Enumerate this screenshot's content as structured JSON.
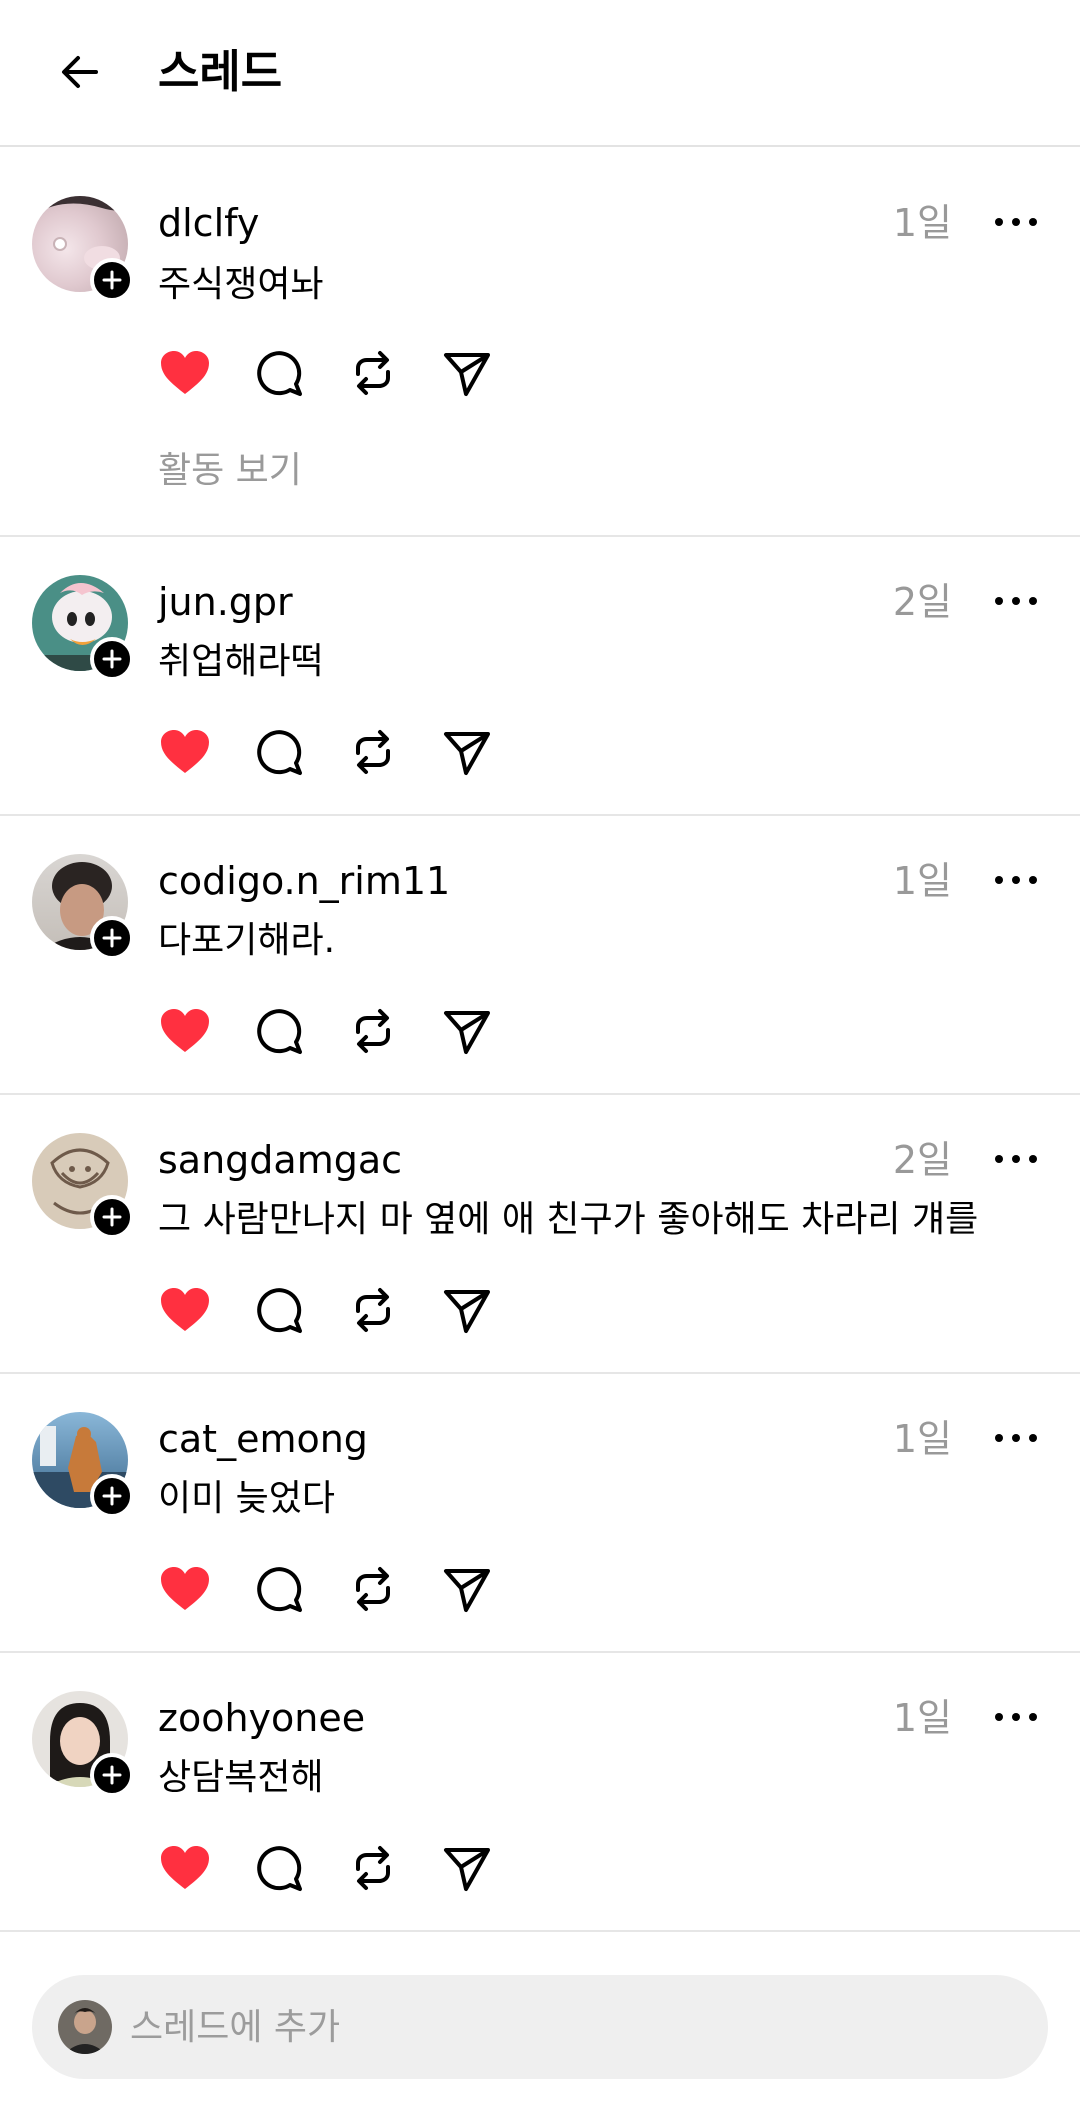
{
  "header": {
    "title": "스레드"
  },
  "posts": [
    {
      "username": "dlclfy",
      "time": "1일",
      "text": "주식쟁여놔",
      "activity": "활동 보기",
      "liked": true
    },
    {
      "username": "jun.gpr",
      "time": "2일",
      "text": "취업해라떡",
      "liked": true
    },
    {
      "username": "codigo.n_rim11",
      "time": "1일",
      "text": "다포기해라.",
      "liked": true
    },
    {
      "username": "sangdamgac",
      "time": "2일",
      "text": "그 사람만나지 마 옆에 애 친구가 좋아해도 차라리 걔를",
      "liked": true
    },
    {
      "username": "cat_emong",
      "time": "1일",
      "text": "이미 늦었다",
      "liked": true
    },
    {
      "username": "zoohyonee",
      "time": "1일",
      "text": "상담복전해",
      "liked": true
    }
  ],
  "composer": {
    "placeholder": "스레드에 추가"
  },
  "colors": {
    "like": "#ff3040",
    "muted": "#999999"
  },
  "icons": [
    "back-arrow-icon",
    "plus-icon",
    "more-icon",
    "heart-icon",
    "comment-icon",
    "repost-icon",
    "share-icon"
  ]
}
